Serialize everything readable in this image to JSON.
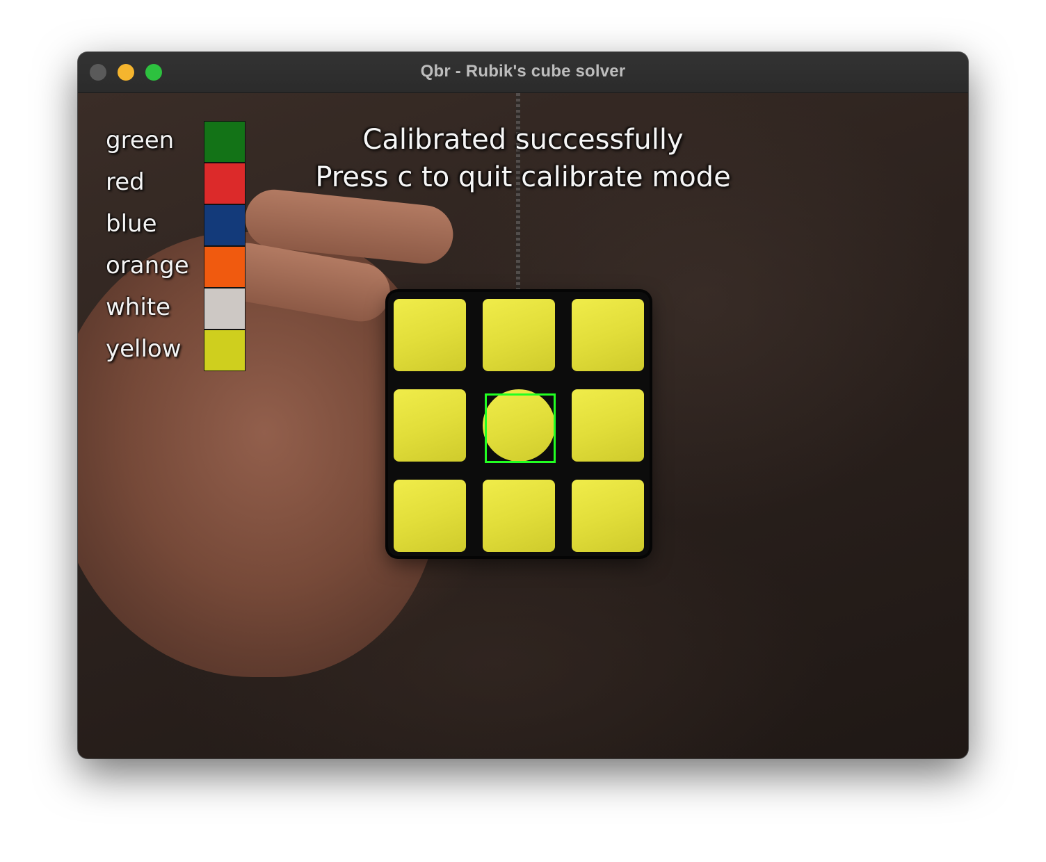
{
  "window": {
    "title": "Qbr - Rubik's cube solver",
    "traffic_lights": [
      {
        "name": "close",
        "color": "#5a5a5a"
      },
      {
        "name": "minimize",
        "color": "#f5b52e"
      },
      {
        "name": "zoom",
        "color": "#2dc13f"
      }
    ]
  },
  "legend": [
    {
      "label": "green",
      "color": "#137317"
    },
    {
      "label": "red",
      "color": "#dc2a2a"
    },
    {
      "label": "blue",
      "color": "#133a7a"
    },
    {
      "label": "orange",
      "color": "#f05a0f"
    },
    {
      "label": "white",
      "color": "#cdc8c4"
    },
    {
      "label": "yellow",
      "color": "#cfcf1e"
    }
  ],
  "status": {
    "line1": "Calibrated successfully",
    "line2": "Press c to quit calibrate mode"
  },
  "cube_face": {
    "stickers": [
      "yellow",
      "yellow",
      "yellow",
      "yellow",
      "yellow",
      "yellow",
      "yellow",
      "yellow",
      "yellow"
    ],
    "highlight_color": "#22ff22",
    "sticker_color": "#e6e23c"
  }
}
